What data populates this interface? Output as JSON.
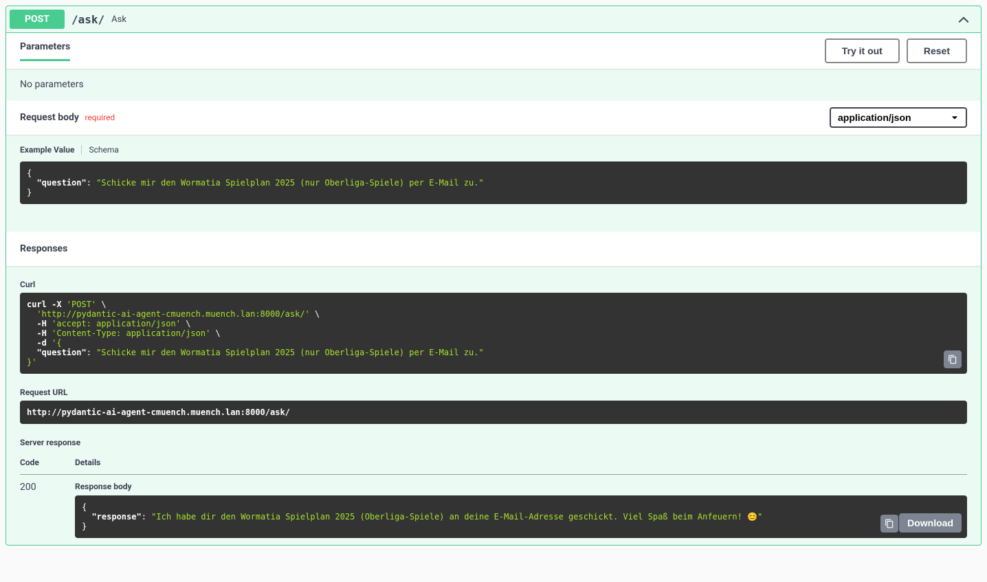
{
  "method": "POST",
  "path": "/ask/",
  "summary": "Ask",
  "parameters": {
    "title": "Parameters",
    "try_it": "Try it out",
    "reset": "Reset",
    "none": "No parameters"
  },
  "request_body": {
    "title": "Request body",
    "required": "required",
    "content_type": "application/json",
    "tabs": {
      "example": "Example Value",
      "schema": "Schema"
    },
    "example_json": {
      "open": "{",
      "key": "\"question\"",
      "colon": ": ",
      "value": "\"Schicke mir den Wormatia Spielplan 2025 (nur Oberliga-Spiele) per E-Mail zu.\"",
      "close": "}"
    }
  },
  "responses": {
    "title": "Responses"
  },
  "curl": {
    "title": "Curl",
    "l1a": "curl -X ",
    "l1b": "'POST'",
    "l1c": " \\",
    "l2a": "  ",
    "l2b": "'http://pydantic-ai-agent-cmuench.muench.lan:8000/ask/'",
    "l2c": " \\",
    "l3a": "  -H ",
    "l3b": "'accept: application/json'",
    "l3c": " \\",
    "l4a": "  -H ",
    "l4b": "'Content-Type: application/json'",
    "l4c": " \\",
    "l5a": "  -d ",
    "l5b": "'{",
    "l6a": "  \"question\"",
    "l6b": ": ",
    "l6c": "\"Schicke mir den Wormatia Spielplan 2025 (nur Oberliga-Spiele) per E-Mail zu.\"",
    "l7": "}'"
  },
  "request_url": {
    "title": "Request URL",
    "value": "http://pydantic-ai-agent-cmuench.muench.lan:8000/ask/"
  },
  "server_response": {
    "title": "Server response",
    "col_code": "Code",
    "col_details": "Details",
    "code": "200",
    "body_label": "Response body",
    "download": "Download",
    "json": {
      "open": "{",
      "key": "\"response\"",
      "colon": ": ",
      "value": "\"Ich habe dir den Wormatia Spielplan 2025 (Oberliga-Spiele) an deine E-Mail-Adresse geschickt. Viel Spaß beim Anfeuern! 😊\"",
      "close": "}"
    }
  }
}
